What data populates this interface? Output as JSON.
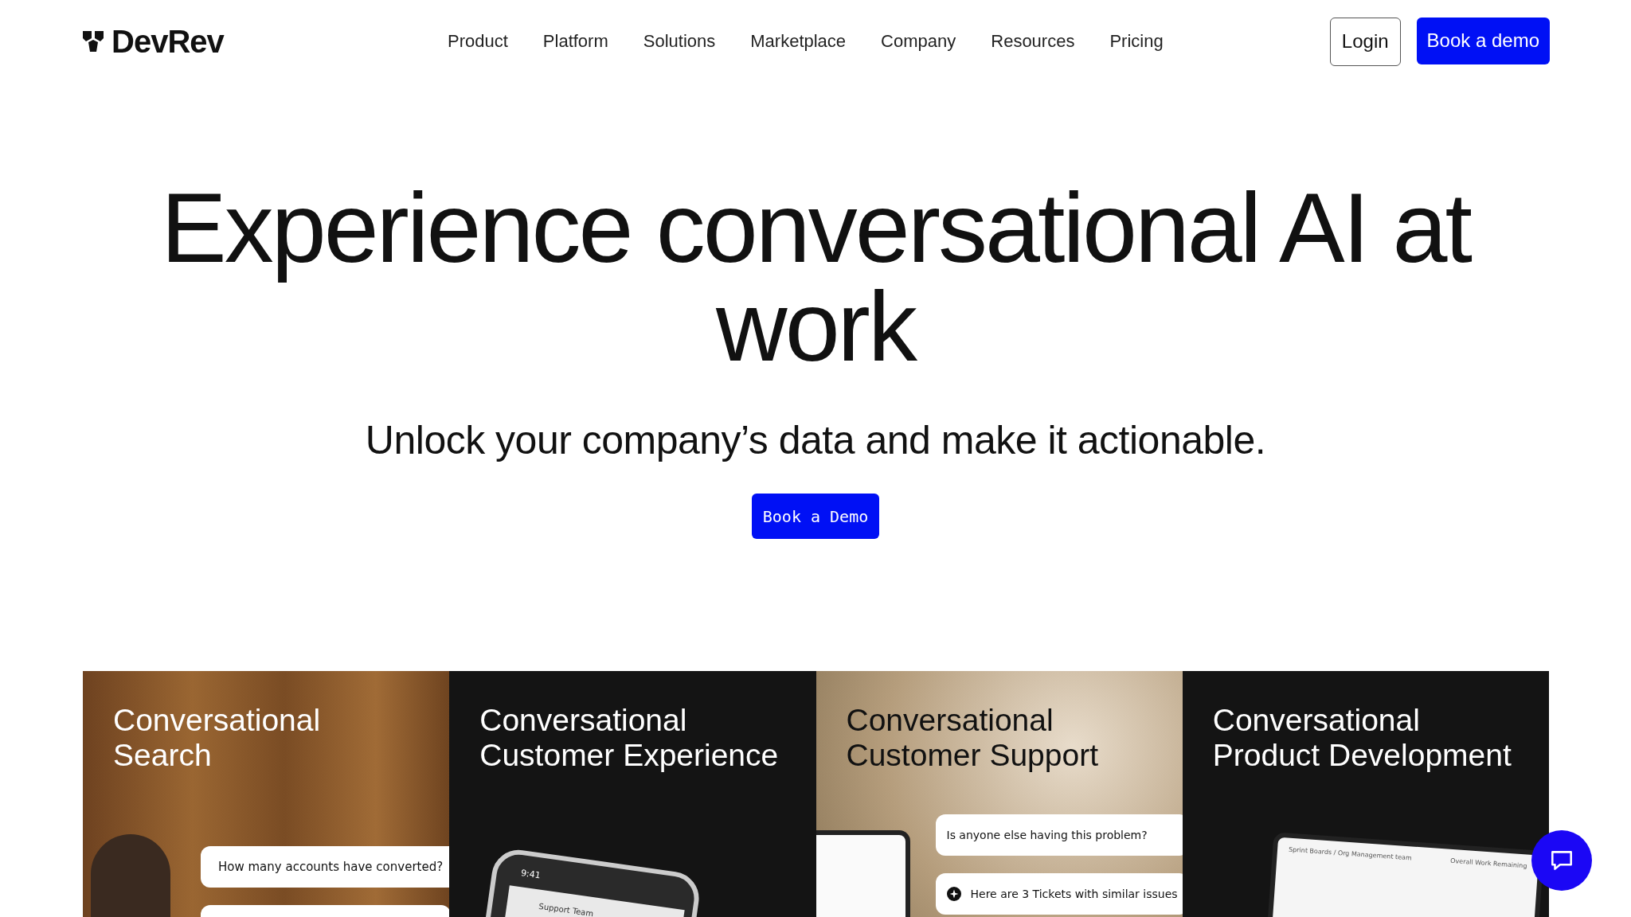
{
  "header": {
    "logo": "DevRev",
    "nav": [
      "Product",
      "Platform",
      "Solutions",
      "Marketplace",
      "Company",
      "Resources",
      "Pricing"
    ],
    "login": "Login",
    "cta": "Book a demo"
  },
  "hero": {
    "title": "Experience conversational AI at work",
    "subtitle": "Unlock your company’s data and make it actionable.",
    "button": "Book a Demo"
  },
  "cards": [
    {
      "kind": "wood",
      "title": [
        "Conversational",
        "Search"
      ],
      "bubbles": [
        "How many accounts have converted?"
      ],
      "mockup": {
        "kind": "person"
      }
    },
    {
      "kind": "dark",
      "title": [
        "Conversational",
        "Customer Experience"
      ],
      "mockup": {
        "kind": "phone",
        "time": "9:41",
        "label": "Support Team"
      }
    },
    {
      "kind": "blur",
      "title": [
        "Conversational",
        "Customer Support"
      ],
      "bubbles": [
        "Is anyone else having this problem?",
        "Here are 3 Tickets with similar issues"
      ],
      "mockup": {
        "kind": "laptop-side"
      }
    },
    {
      "kind": "dark",
      "title": [
        "Conversational",
        "Product Development"
      ],
      "mockup": {
        "kind": "laptop",
        "crumb": "Sprint Boards / Org Management team",
        "side": "Overall Work Remaining"
      }
    }
  ]
}
